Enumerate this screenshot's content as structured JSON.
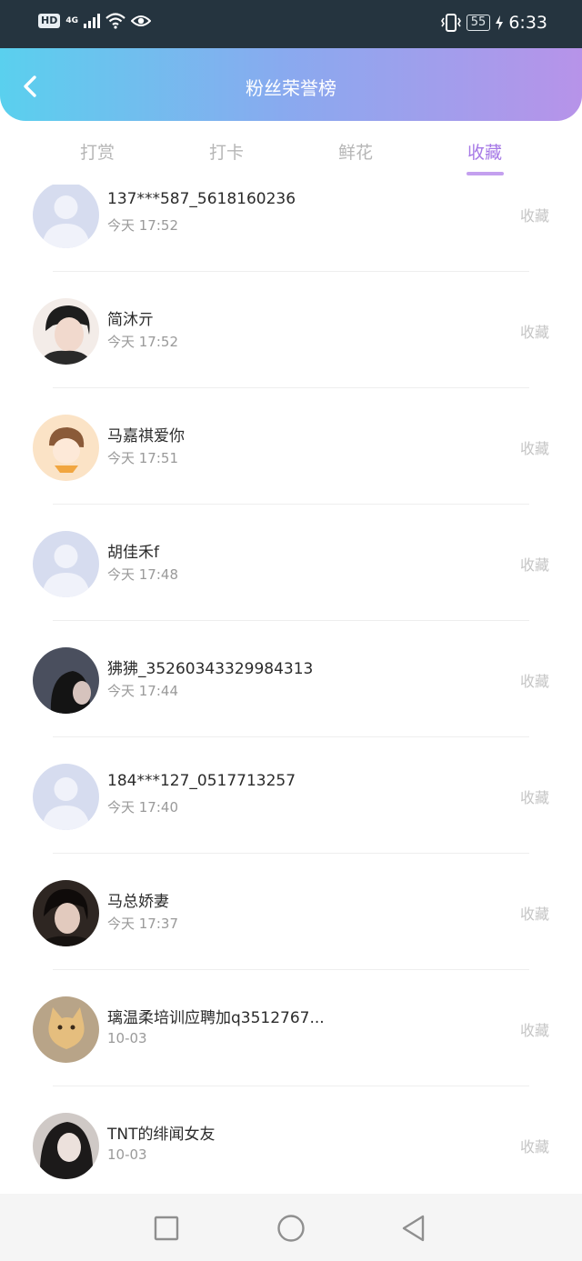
{
  "status_bar": {
    "hd": "HD",
    "network": "4G",
    "battery": "55",
    "time": "6:33"
  },
  "header": {
    "title": "粉丝荣誉榜",
    "back_icon": "chevron-left-icon"
  },
  "tabs": [
    {
      "label": "打赏",
      "active": false
    },
    {
      "label": "打卡",
      "active": false
    },
    {
      "label": "鲜花",
      "active": false
    },
    {
      "label": "收藏",
      "active": true
    }
  ],
  "list": [
    {
      "name": "137***587_5618160236",
      "time": "今天 17:52",
      "action": "收藏",
      "avatar": "default-avatar"
    },
    {
      "name": "简沐亓",
      "time": "今天 17:52",
      "action": "收藏",
      "avatar": "photo-avatar"
    },
    {
      "name": "马嘉祺爱你",
      "time": "今天 17:51",
      "action": "收藏",
      "avatar": "cartoon-avatar"
    },
    {
      "name": "胡佳禾f",
      "time": "今天 17:48",
      "action": "收藏",
      "avatar": "default-avatar"
    },
    {
      "name": "狒狒_35260343329984313",
      "time": "今天 17:44",
      "action": "收藏",
      "avatar": "photo-avatar"
    },
    {
      "name": "184***127_0517713257",
      "time": "今天 17:40",
      "action": "收藏",
      "avatar": "default-avatar"
    },
    {
      "name": "马总娇妻",
      "time": "今天 17:37",
      "action": "收藏",
      "avatar": "photo-avatar"
    },
    {
      "name": "璃温柔培训应聘加q3512767...",
      "time": "10-03",
      "action": "收藏",
      "avatar": "cat-avatar"
    },
    {
      "name": "TNT的绯闻女友",
      "time": "10-03",
      "action": "收藏",
      "avatar": "photo-avatar"
    }
  ],
  "nav_bar": {
    "recents_icon": "square-icon",
    "home_icon": "circle-icon",
    "back_icon": "triangle-back-icon"
  }
}
